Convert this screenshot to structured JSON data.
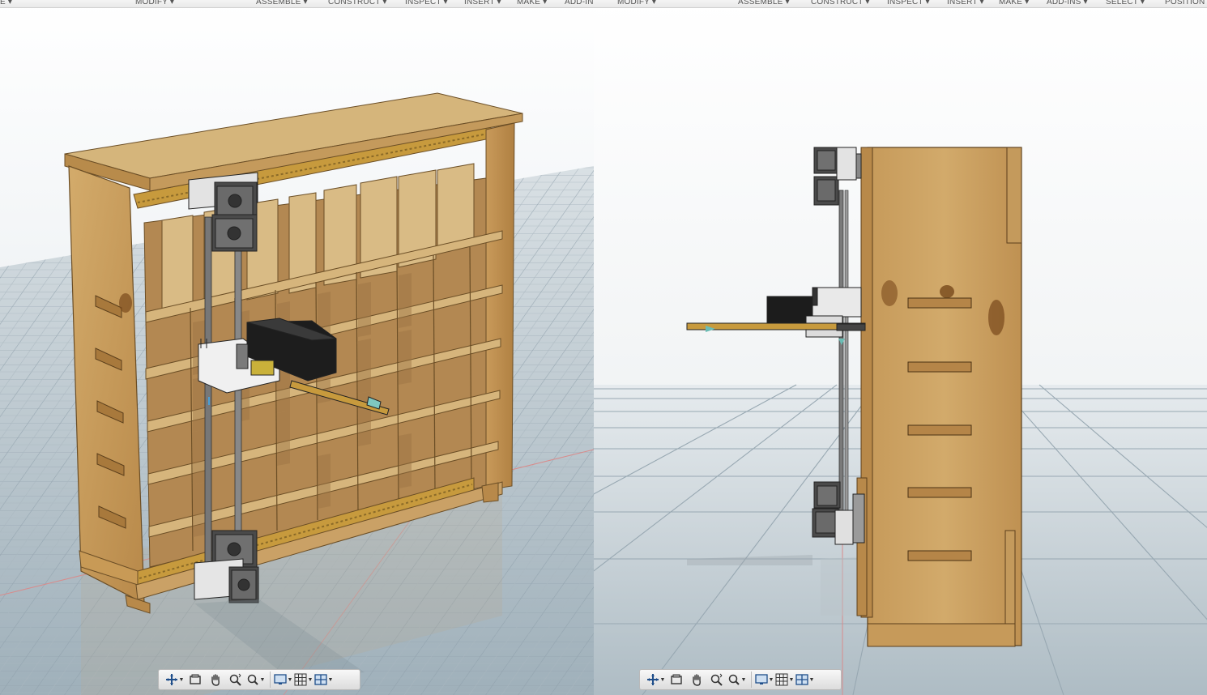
{
  "left_view": {
    "menu": [
      {
        "label": "E ▾"
      },
      {
        "label": "MODIFY ▾"
      },
      {
        "label": "ASSEMBLE ▾"
      },
      {
        "label": "CONSTRUCT ▾"
      },
      {
        "label": "INSPECT ▾"
      },
      {
        "label": "INSERT ▾"
      },
      {
        "label": "MAKE ▾"
      },
      {
        "label": "ADD-IN"
      }
    ]
  },
  "right_view": {
    "menu": [
      {
        "label": "MODIFY ▾"
      },
      {
        "label": "ASSEMBLE ▾"
      },
      {
        "label": "CONSTRUCT ▾"
      },
      {
        "label": "INSPECT ▾"
      },
      {
        "label": "INSERT ▾"
      },
      {
        "label": "MAKE ▾"
      },
      {
        "label": "ADD-INS ▾"
      },
      {
        "label": "SELECT ▾"
      },
      {
        "label": "POSITION ▾"
      }
    ]
  },
  "navigation_bar": {
    "tools": [
      {
        "icon": "orbit-icon",
        "has_dropdown": true
      },
      {
        "icon": "look-at-icon",
        "has_dropdown": false
      },
      {
        "icon": "pan-hand-icon",
        "has_dropdown": false
      },
      {
        "icon": "zoom-icon",
        "has_dropdown": false
      },
      {
        "icon": "fit-window-icon",
        "has_dropdown": true
      },
      {
        "icon": "display-settings-icon",
        "has_dropdown": true
      },
      {
        "icon": "grid-snaps-icon",
        "has_dropdown": true
      },
      {
        "icon": "viewports-icon",
        "has_dropdown": true
      }
    ]
  },
  "colors": {
    "wood": "#c9a064",
    "wood_dark": "#a07842",
    "rail": "#c79a3d",
    "motor_body": "#707070",
    "grid_floor": "#b6c3cb"
  }
}
